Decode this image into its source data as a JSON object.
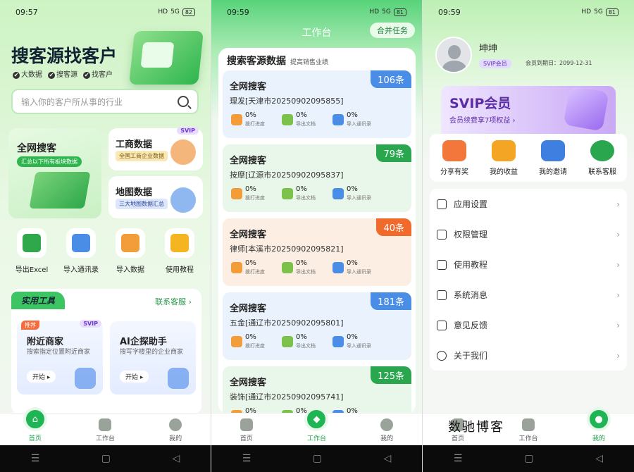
{
  "colors": {
    "brand_green": "#1fb454",
    "vip_purple": "#6a3cc9",
    "badge_blue": "#4a8de6",
    "badge_green": "#2aa64f",
    "badge_orange": "#f06a2c"
  },
  "screens": {
    "home": {
      "status": {
        "time": "09:57",
        "signal": "HD",
        "network": "5G",
        "battery": "82"
      },
      "title": "搜客源找客户",
      "tags": [
        "大数据",
        "搜客源",
        "找客户"
      ],
      "search_placeholder": "输入你的客户所从事的行业",
      "card_qw": {
        "title": "全网搜客",
        "subtitle": "汇总以下所有板块数据"
      },
      "card_gs": {
        "title": "工商数据",
        "subtitle": "全国工商企业数据",
        "badge": "SVIP"
      },
      "card_dt": {
        "title": "地图数据",
        "subtitle": "三大地图数据汇总"
      },
      "quick": [
        {
          "label": "导出Excel",
          "icon": "excel-icon"
        },
        {
          "label": "导入通讯录",
          "icon": "contacts-icon"
        },
        {
          "label": "导入数据",
          "icon": "import-data-icon"
        },
        {
          "label": "使用教程",
          "icon": "video-icon"
        }
      ],
      "tools": {
        "title": "实用工具",
        "service": "联系客服 ›",
        "items": [
          {
            "tag": "推荐",
            "badge": "SVIP",
            "title": "附近商家",
            "desc": "搜索指定位置附近商家",
            "action": "开始 ▸"
          },
          {
            "title": "AI企探助手",
            "desc": "搜写字楼里的企业商家",
            "action": "开始 ▸"
          }
        ]
      },
      "tabs": [
        "首页",
        "工作台",
        "我的"
      ]
    },
    "work": {
      "status": {
        "time": "09:59",
        "signal": "HD",
        "network": "5G",
        "battery": "81"
      },
      "header": "工作台",
      "merge_btn": "合并任务",
      "panel_title": "搜索客源数据",
      "panel_sub": "提高销售业绩",
      "records": [
        {
          "title": "全网搜客",
          "sub": "理发[天津市20250902095855]",
          "count": "106条",
          "color": "#4a8de6",
          "bg": "#eaf3fd"
        },
        {
          "title": "全网搜客",
          "sub": "按摩[辽源市20250902095837]",
          "count": "79条",
          "color": "#2aa64f",
          "bg": "#e9f7ea"
        },
        {
          "title": "全网搜客",
          "sub": "律师[本溪市20250902095821]",
          "count": "40条",
          "color": "#f06a2c",
          "bg": "#fdeee3"
        },
        {
          "title": "全网搜客",
          "sub": "五金[通辽市20250902095801]",
          "count": "181条",
          "color": "#4a8de6",
          "bg": "#eaf3fd"
        },
        {
          "title": "全网搜客",
          "sub": "装饰[通辽市20250902095741]",
          "count": "125条",
          "color": "#2aa64f",
          "bg": "#e9f7ea"
        }
      ],
      "stat_labels": [
        "拨打进度",
        "导出文档",
        "导入通讯录"
      ],
      "stat_value": "0%",
      "tabs": [
        "首页",
        "工作台",
        "我的"
      ]
    },
    "me": {
      "status": {
        "time": "09:59",
        "signal": "HD",
        "network": "5G",
        "battery": "81"
      },
      "username": "坤坤",
      "vip_badge": "SVIP会员",
      "expire": "会员到期日：2099-12-31",
      "vip_card": {
        "title": "SVIP会员",
        "sub": "会员续费享7项权益 ›"
      },
      "actions": [
        {
          "label": "分享有奖",
          "icon": "share-icon"
        },
        {
          "label": "我的收益",
          "icon": "coin-icon"
        },
        {
          "label": "我的邀请",
          "icon": "invite-icon"
        },
        {
          "label": "联系客服",
          "icon": "service-icon"
        }
      ],
      "menu": [
        "应用设置",
        "权限管理",
        "使用教程",
        "系统消息",
        "意见反馈",
        "关于我们"
      ],
      "tabs": [
        "首页",
        "工作台",
        "我的"
      ],
      "watermark": "数驰博客"
    }
  }
}
